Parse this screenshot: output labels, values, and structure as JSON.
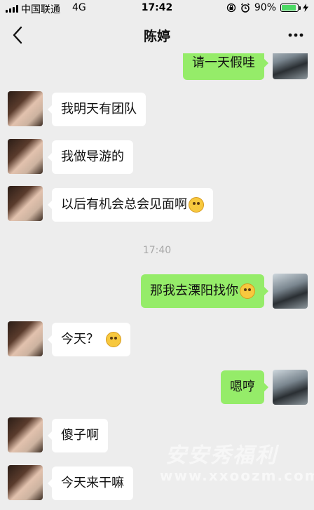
{
  "status_bar": {
    "carrier": "中国联通",
    "network": "4G",
    "time": "17:42",
    "battery_percent": "90%",
    "battery_level": 0.9,
    "battery_color": "#4cd964"
  },
  "nav": {
    "title": "陈婷",
    "back_icon": "chevron-left-icon",
    "more_icon": "more-dots-icon"
  },
  "messages": [
    {
      "from": "me",
      "text": "请一天假哇"
    },
    {
      "from": "her",
      "text": "我明天有团队"
    },
    {
      "from": "her",
      "text": "我做导游的"
    },
    {
      "from": "her",
      "text": "以后有机会总会见面啊",
      "emoji": "wink-tongue-emoji"
    },
    {
      "from": "me",
      "text": "那我去溧阳找你",
      "emoji": "grimace-emoji"
    },
    {
      "from": "her",
      "text": "今天？",
      "emoji": "shocked-emoji"
    },
    {
      "from": "me",
      "text": "嗯哼"
    },
    {
      "from": "her",
      "text": "傻子啊"
    },
    {
      "from": "her",
      "text": "今天来干嘛"
    }
  ],
  "timestamp": "17:40",
  "watermark": {
    "text": "安安秀福利",
    "sub": "www.xxoozm.com"
  },
  "colors": {
    "background": "#ededed",
    "my_bubble": "#95ec69",
    "her_bubble": "#ffffff"
  }
}
